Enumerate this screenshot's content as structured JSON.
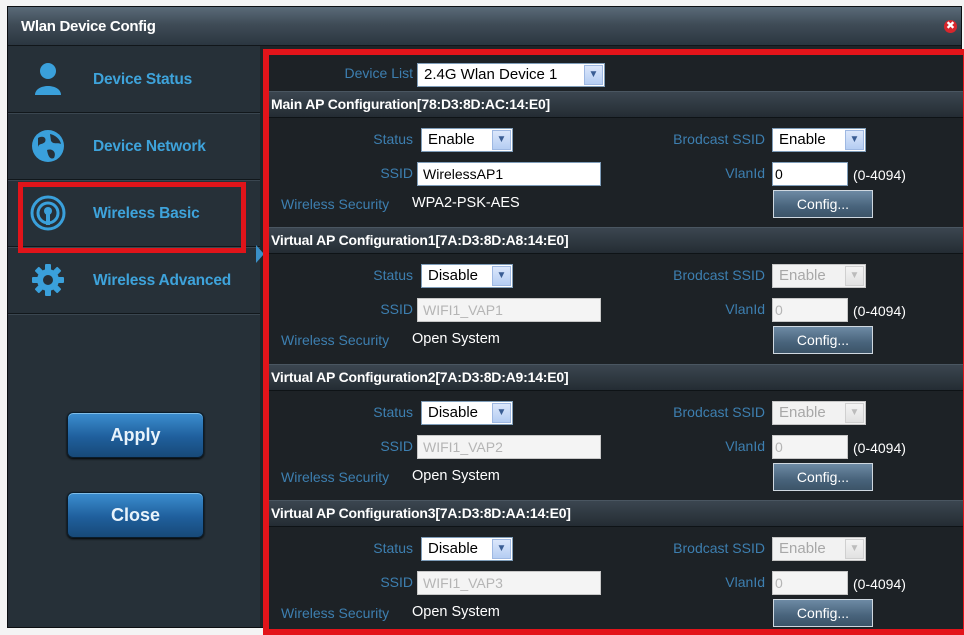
{
  "window": {
    "title": "Wlan Device Config",
    "close_glyph": "✖"
  },
  "sidebar": {
    "items": [
      {
        "label": "Device Status",
        "icon": "user-icon"
      },
      {
        "label": "Device Network",
        "icon": "globe-icon"
      },
      {
        "label": "Wireless Basic",
        "icon": "wireless-icon"
      },
      {
        "label": "Wireless Advanced",
        "icon": "gear-icon"
      }
    ],
    "apply_label": "Apply",
    "close_label": "Close"
  },
  "device_list": {
    "label": "Device List",
    "value": "2.4G Wlan Device 1"
  },
  "sections": [
    {
      "title": "Main AP Configuration[78:D3:8D:AC:14:E0]",
      "status_label": "Status",
      "status": "Enable",
      "broadcast_label": "Brodcast SSID",
      "broadcast": "Enable",
      "ssid_label": "SSID",
      "ssid": "WirelessAP1",
      "vlan_label": "VlanId",
      "vlan": "0",
      "vlan_range": "(0-4094)",
      "security_label": "Wireless Security",
      "security": "WPA2-PSK-AES",
      "config_label": "Config..."
    },
    {
      "title": "Virtual AP Configuration1[7A:D3:8D:A8:14:E0]",
      "status_label": "Status",
      "status": "Disable",
      "broadcast_label": "Brodcast SSID",
      "broadcast": "Enable",
      "ssid_label": "SSID",
      "ssid": "WIFI1_VAP1",
      "vlan_label": "VlanId",
      "vlan": "0",
      "vlan_range": "(0-4094)",
      "security_label": "Wireless Security",
      "security": "Open System",
      "config_label": "Config..."
    },
    {
      "title": "Virtual AP Configuration2[7A:D3:8D:A9:14:E0]",
      "status_label": "Status",
      "status": "Disable",
      "broadcast_label": "Brodcast SSID",
      "broadcast": "Enable",
      "ssid_label": "SSID",
      "ssid": "WIFI1_VAP2",
      "vlan_label": "VlanId",
      "vlan": "0",
      "vlan_range": "(0-4094)",
      "security_label": "Wireless Security",
      "security": "Open System",
      "config_label": "Config..."
    },
    {
      "title": "Virtual AP Configuration3[7A:D3:8D:AA:14:E0]",
      "status_label": "Status",
      "status": "Disable",
      "broadcast_label": "Brodcast SSID",
      "broadcast": "Enable",
      "ssid_label": "SSID",
      "ssid": "WIFI1_VAP3",
      "vlan_label": "VlanId",
      "vlan": "0",
      "vlan_range": "(0-4094)",
      "security_label": "Wireless Security",
      "security": "Open System",
      "config_label": "Config..."
    }
  ],
  "colors": {
    "highlight_red": "#e3141a",
    "label_blue": "#3ea3db",
    "field_label_blue": "#3d7fb0"
  }
}
